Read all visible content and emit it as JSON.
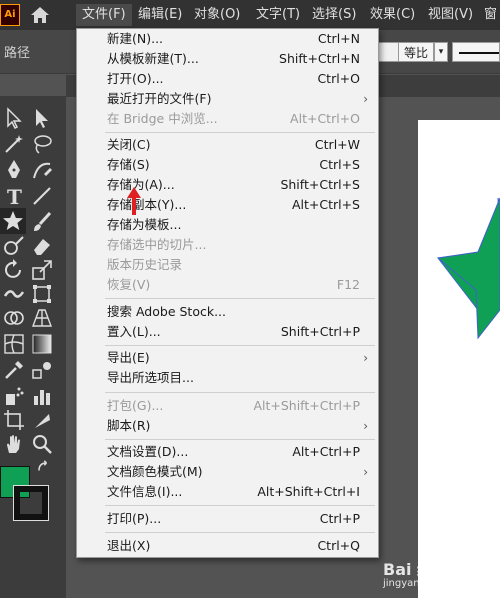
{
  "app": {
    "logo": "Ai"
  },
  "menubar": {
    "items": [
      "文件(F)",
      "编辑(E)",
      "对象(O)",
      "文字(T)",
      "选择(S)",
      "效果(C)",
      "视图(V)",
      "窗"
    ]
  },
  "controlbar": {
    "object_type": "路径",
    "ratio_label": "等比"
  },
  "file_menu": {
    "items": [
      {
        "label": "新建(N)...",
        "shortcut": "Ctrl+N"
      },
      {
        "label": "从模板新建(T)...",
        "shortcut": "Shift+Ctrl+N"
      },
      {
        "label": "打开(O)...",
        "shortcut": "Ctrl+O"
      },
      {
        "label": "最近打开的文件(F)",
        "shortcut": ""
      },
      {
        "label": "在 Bridge 中浏览...",
        "shortcut": "Alt+Ctrl+O"
      },
      {
        "label": "关闭(C)",
        "shortcut": "Ctrl+W"
      },
      {
        "label": "存储(S)",
        "shortcut": "Ctrl+S"
      },
      {
        "label": "存储为(A)...",
        "shortcut": "Shift+Ctrl+S"
      },
      {
        "label": "存储副本(Y)...",
        "shortcut": "Alt+Ctrl+S"
      },
      {
        "label": "存储为模板...",
        "shortcut": ""
      },
      {
        "label": "存储选中的切片...",
        "shortcut": ""
      },
      {
        "label": "版本历史记录",
        "shortcut": ""
      },
      {
        "label": "恢复(V)",
        "shortcut": "F12"
      },
      {
        "label": "搜索 Adobe Stock...",
        "shortcut": ""
      },
      {
        "label": "置入(L)...",
        "shortcut": "Shift+Ctrl+P"
      },
      {
        "label": "导出(E)",
        "shortcut": ""
      },
      {
        "label": "导出所选项目...",
        "shortcut": ""
      },
      {
        "label": "打包(G)...",
        "shortcut": "Alt+Shift+Ctrl+P"
      },
      {
        "label": "脚本(R)",
        "shortcut": ""
      },
      {
        "label": "文档设置(D)...",
        "shortcut": "Alt+Ctrl+P"
      },
      {
        "label": "文档颜色模式(M)",
        "shortcut": ""
      },
      {
        "label": "文件信息(I)...",
        "shortcut": "Alt+Shift+Ctrl+I"
      },
      {
        "label": "打印(P)...",
        "shortcut": "Ctrl+P"
      },
      {
        "label": "退出(X)",
        "shortcut": "Ctrl+Q"
      }
    ]
  },
  "colors": {
    "fill": "#10a055",
    "star": "#10a055",
    "accent_arrow": "#e02020"
  },
  "icons": [
    "home-icon",
    "selection-tool-icon",
    "direct-selection-icon",
    "magic-wand-icon",
    "lasso-icon",
    "pen-icon",
    "curvature-icon",
    "type-icon",
    "line-icon",
    "star-icon",
    "paintbrush-icon",
    "shaper-icon",
    "eraser-icon",
    "rotate-icon",
    "scale-icon",
    "warp-icon",
    "free-transform-icon",
    "shape-builder-icon",
    "perspective-grid-icon",
    "mesh-icon",
    "gradient-icon",
    "eyedropper-icon",
    "blend-icon",
    "symbol-sprayer-icon",
    "column-graph-icon",
    "artboard-icon",
    "slice-icon",
    "hand-icon",
    "zoom-icon",
    "swap-colors-icon"
  ],
  "watermark": {
    "brand": "Bai 经验",
    "url": "jingyan.baidu.com"
  }
}
